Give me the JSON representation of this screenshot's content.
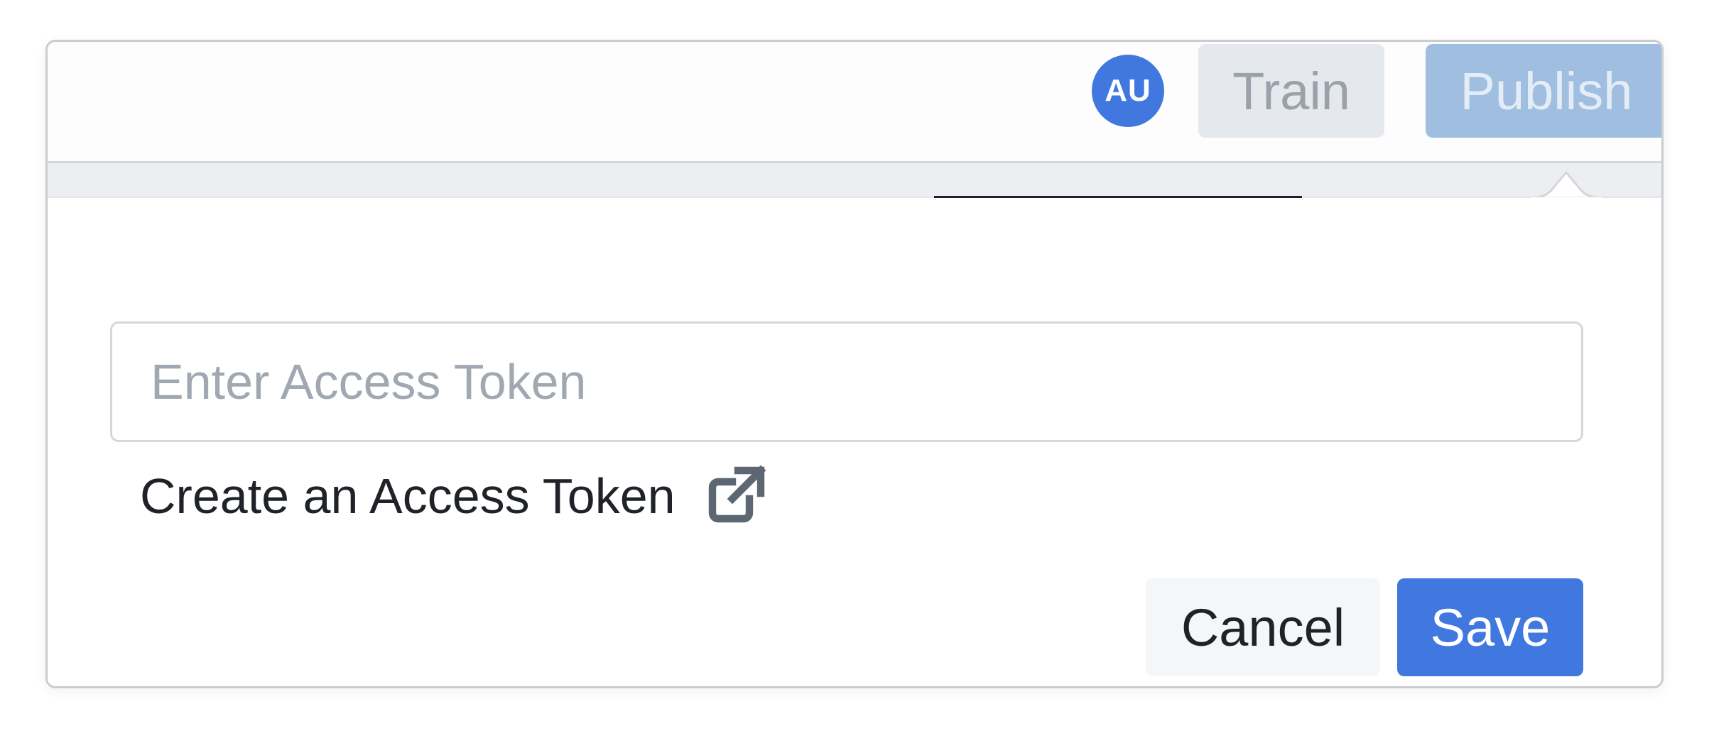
{
  "header": {
    "avatar_initials": "AU",
    "train_label": "Train",
    "publish_label": "Publish"
  },
  "token_form": {
    "input_placeholder": "Enter Access Token",
    "input_value": "",
    "create_link_label": "Create an Access Token",
    "create_link_icon": "external-link-icon",
    "cancel_label": "Cancel",
    "save_label": "Save"
  },
  "colors": {
    "accent": "#4178e0",
    "publish_disabled": "#9fbee0",
    "train_disabled": "#e5e9ed"
  }
}
